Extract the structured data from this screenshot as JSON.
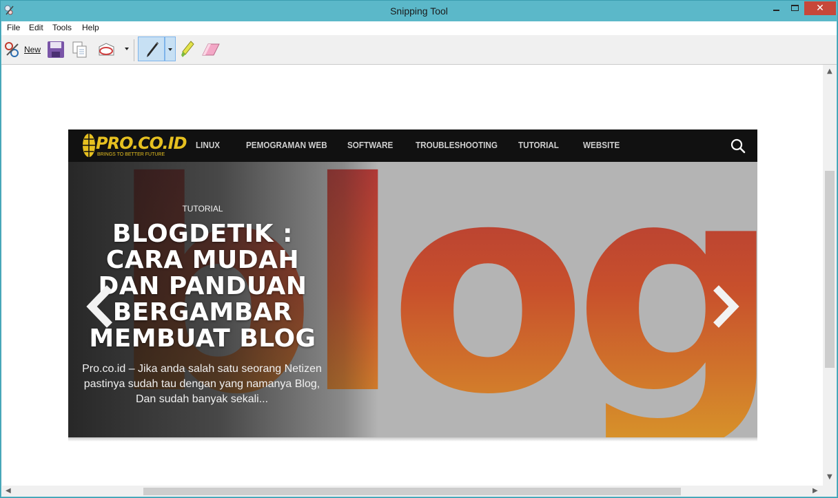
{
  "window": {
    "title": "Snipping Tool",
    "close_glyph": "✕"
  },
  "menu": {
    "items": [
      "File",
      "Edit",
      "Tools",
      "Help"
    ]
  },
  "toolbar": {
    "new_label": "New",
    "icons": [
      "scissors-icon",
      "save-icon",
      "copy-icon",
      "send-snip-icon",
      "pen-icon",
      "highlighter-icon",
      "eraser-icon"
    ]
  },
  "site": {
    "logo": "PRO.CO.ID",
    "logo_tagline": "BRINGS TO BETTER FUTURE",
    "nav": [
      "LINUX",
      "PEMOGRAMAN WEB",
      "SOFTWARE",
      "TROUBLESHOOTING",
      "TUTORIAL",
      "WEBSITE"
    ],
    "hero": {
      "category": "TUTORIAL",
      "headline": [
        "BLOGDETIK :",
        "CARA MUDAH",
        "DAN PANDUAN",
        "BERGAMBAR",
        "MEMBUAT BLOG"
      ],
      "excerpt": [
        "Pro.co.id – Jika anda salah satu seorang Netizen",
        "pastinya sudah tau dengan yang namanya Blog,",
        "Dan sudah banyak sekali..."
      ],
      "background_word": "blog"
    }
  },
  "colors": {
    "titlebar": "#5bb8c9",
    "accent_yellow": "#e6c020",
    "close_red": "#c7473a"
  }
}
